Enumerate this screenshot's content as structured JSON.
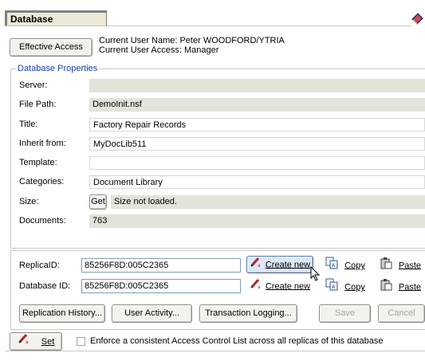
{
  "header": {
    "title": "Database"
  },
  "user": {
    "effective_access_label": "Effective Access",
    "name_line": "Current User Name: Peter WOODFORD/YTRIA",
    "access_line": "Current User Access: Manager"
  },
  "properties": {
    "group_label": "Database Properties",
    "server_label": "Server:",
    "server_value": "",
    "filepath_label": "File Path:",
    "filepath_value": "DemoInit.nsf",
    "title_label": "Title:",
    "title_value": "Factory Repair Records",
    "inherit_label": "Inherit from:",
    "inherit_value": "MyDocLib511",
    "template_label": "Template:",
    "template_value": "",
    "categories_label": "Categories:",
    "categories_value": "Document Library",
    "size_label": "Size:",
    "size_get": "Get",
    "size_value": "Size not loaded.",
    "documents_label": "Documents:",
    "documents_value": "763"
  },
  "ids": {
    "replica_label": "ReplicaID:",
    "replica_value": "85256F8D:005C2365",
    "database_label": "Database ID:",
    "database_value": "85256F8D:005C2365",
    "create_new": "Create new",
    "copy": "Copy",
    "paste": "Paste"
  },
  "actions": {
    "replication_history": "Replication History...",
    "user_activity": "User Activity...",
    "transaction_logging": "Transaction Logging...",
    "save": "Save",
    "cancel": "Cancel"
  },
  "footer": {
    "set_label": "Set",
    "enforce_acl_label": "Enforce a consistent Access Control List across all replicas of this database",
    "enforce_acl_checked": false
  }
}
